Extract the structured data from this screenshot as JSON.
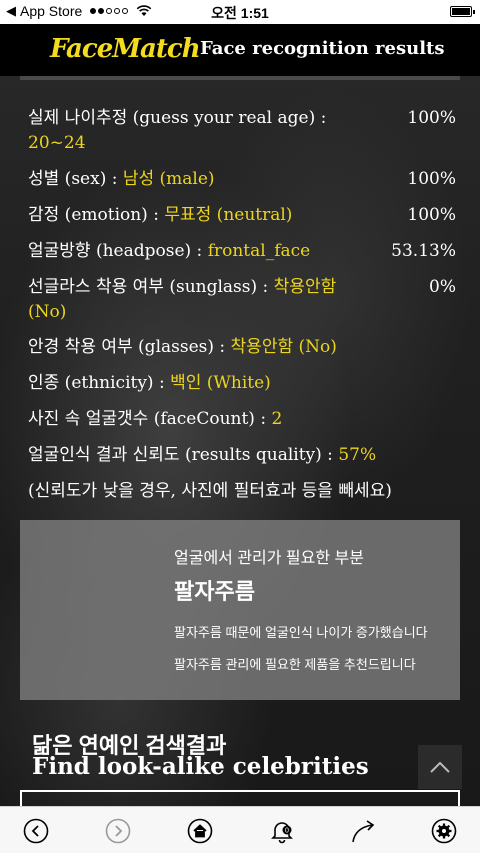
{
  "status_bar": {
    "carrier": "App Store",
    "time": "오전 1:51",
    "signal_dots_filled": 2,
    "signal_dots_total": 5
  },
  "header": {
    "logo": "FaceMatch",
    "title": "Face recognition results"
  },
  "results": [
    {
      "label": "실제 나이추정 (guess your real age) :",
      "value": "20~24",
      "percent": "100%"
    },
    {
      "label": "성별 (sex) :",
      "value": "남성 (male)",
      "percent": "100%"
    },
    {
      "label": "감정 (emotion) :",
      "value": "무표정 (neutral)",
      "percent": "100%"
    },
    {
      "label": "얼굴방향 (headpose) :",
      "value": "frontal_face",
      "percent": "53.13%"
    },
    {
      "label": "선글라스 착용 여부 (sunglass) :",
      "value": "착용안함",
      "value_line2": "(No)",
      "percent": "0%"
    },
    {
      "label": "안경 착용 여부 (glasses) :",
      "value": "착용안함 (No)"
    },
    {
      "label": "인종 (ethnicity) :",
      "value": "백인 (White)"
    },
    {
      "label": "사진 속 얼굴갯수 (faceCount) :",
      "value": "2"
    },
    {
      "label": "얼굴인식 결과 신뢰도 (results quality) :",
      "value": "57%"
    }
  ],
  "note": "(신뢰도가 낮을 경우, 사진에 필터효과 등을 빼세요)",
  "panel": {
    "subtitle": "얼굴에서 관리가 필요한 부분",
    "title": "팔자주름",
    "line1": "팔자주름 때문에 얼굴인식 나이가 증가했습니다",
    "line2": "팔자주름 관리에 필요한 제품을 추천드립니다"
  },
  "celebrities": {
    "title_ko": "닮은 연예인 검색결과",
    "title_en": "Find look-alike celebrities"
  },
  "toolbar": {
    "icons": [
      "back-icon",
      "forward-icon",
      "home-icon",
      "notification-bell-icon",
      "share-icon",
      "settings-icon"
    ],
    "notification_count": "0"
  },
  "colors": {
    "accent_yellow": "#ecd51c",
    "logo_yellow": "#f2dc1d",
    "panel_grey": "#808080"
  }
}
